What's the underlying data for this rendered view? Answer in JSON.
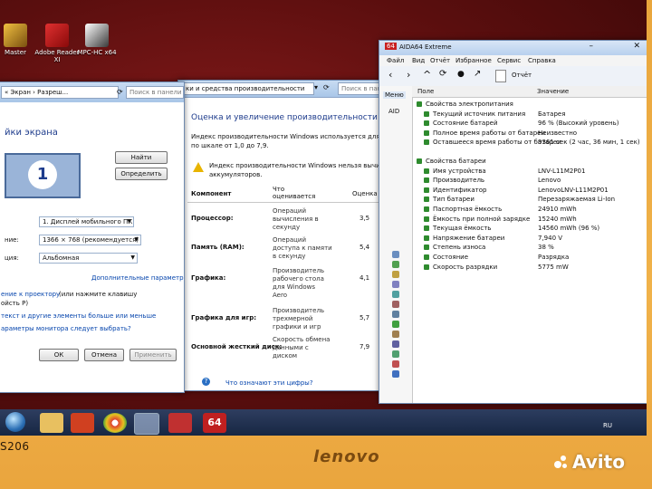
{
  "desktop": {
    "icons": [
      {
        "label": "Master"
      },
      {
        "label": "Adobe Reader XI"
      },
      {
        "label": "MPC-HC x64"
      }
    ]
  },
  "display_window": {
    "breadcrumb": "« Экран › Разреш...",
    "search_placeholder": "Поиск в панели упр...",
    "title": "йки экрана",
    "find_button": "Найти",
    "detect_button": "Определить",
    "display_select": "1. Дисплей мобильного ПК",
    "resolution_label": "ние:",
    "resolution_select": "1366 × 768 (рекомендуется)",
    "orientation_label": "ция:",
    "orientation_select": "Альбомная",
    "advanced_link": "Дополнительные параметры",
    "projector_link": "ение к проектору",
    "projector_hint": "(или нажмите клавишу",
    "projector_hint2": "ойсть P)",
    "text_link": "текст и другие элементы больше или меньше",
    "monitor_link": "араметры монитора следует выбрать?",
    "ok_button": "ОК",
    "cancel_button": "Отмена",
    "apply_button": "Применить",
    "monitor_number": "1"
  },
  "perf_window": {
    "address": "ки и средства производительности",
    "search_placeholder": "Поиск в панели упр...",
    "heading": "Оценка и увеличение производительности компьютера",
    "intro": "Индекс производительности Windows используется для оценки",
    "intro2": "по шкале от 1,0 до 7,9.",
    "warning": "Индекс производительности Windows нельзя вычислить",
    "warning2": "аккумуляторов.",
    "col_component": "Компонент",
    "col_rated": "Что оценивается",
    "col_score": "Оценка",
    "rows": [
      {
        "component": "Процессор:",
        "rated": [
          "Операций",
          "вычисления в",
          "секунду"
        ],
        "score": "3,5"
      },
      {
        "component": "Память (RAM):",
        "rated": [
          "Операций",
          "доступа к памяти",
          "в секунду"
        ],
        "score": "5,4"
      },
      {
        "component": "Графика:",
        "rated": [
          "Производитель",
          "рабочего стола",
          "для Windows",
          "Aero"
        ],
        "score": "4,1"
      },
      {
        "component": "Графика для игр:",
        "rated": [
          "Производитель",
          "трехмерной",
          "графики и игр"
        ],
        "score": "5,7"
      },
      {
        "component": "Основной жесткий диск:",
        "rated": [
          "Скорость обмена",
          "данными с",
          "диском"
        ],
        "score": "7,9"
      }
    ],
    "help_link": "Что означают эти цифры?"
  },
  "aida_window": {
    "title": "AIDA64 Extreme",
    "menu": [
      "Файл",
      "Вид",
      "Отчёт",
      "Избранное",
      "Сервис",
      "Справка"
    ],
    "report_button": "Отчёт",
    "tree_tab": "Меню",
    "tree_root": "AID",
    "col_field": "Поле",
    "col_value": "Значение",
    "power_group": "Свойства электропитания",
    "power_rows": [
      {
        "key": "Текущий источник питания",
        "value": "Батарея"
      },
      {
        "key": "Состояние батарей",
        "value": "96 % (Высокий уровень)"
      },
      {
        "key": "Полное время работы от батареи",
        "value": "Неизвестно"
      },
      {
        "key": "Оставшееся время работы от батареи",
        "value": "9361 сек (2 час, 36 мин, 1 сек)"
      }
    ],
    "battery_group": "Свойства батареи",
    "battery_rows": [
      {
        "key": "Имя устройства",
        "value": "LNV-L11M2P01"
      },
      {
        "key": "Производитель",
        "value": "Lenovo"
      },
      {
        "key": "Идентификатор",
        "value": "LenovoLNV-L11M2P01"
      },
      {
        "key": "Тип батареи",
        "value": "Перезаряжаемая Li-Ion"
      },
      {
        "key": "Паспортная ёмкость",
        "value": "24910 mWh"
      },
      {
        "key": "Ёмкость при полной зарядке",
        "value": "15240 mWh"
      },
      {
        "key": "Текущая ёмкость",
        "value": "14560 mWh  (96 %)"
      },
      {
        "key": "Напряжение батареи",
        "value": "7,940 V"
      },
      {
        "key": "Степень износа",
        "value": "38 %"
      },
      {
        "key": "Состояние",
        "value": "Разрядка"
      },
      {
        "key": "Скорость разрядки",
        "value": "5775 mW"
      }
    ]
  },
  "taskbar": {
    "language": "RU",
    "aida_badge": "64"
  },
  "device": {
    "model": "S206",
    "brand": "lenovo",
    "watermark": "Avito"
  }
}
